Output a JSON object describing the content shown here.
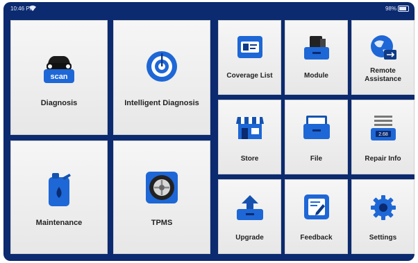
{
  "status": {
    "time": "10:46 PM",
    "battery_percent": "98%",
    "icons": [
      "wifi-icon",
      "battery-icon"
    ]
  },
  "left_panel": {
    "tiles": [
      {
        "label": "Diagnosis",
        "icon": "car-scan-icon",
        "icon_text": "scan"
      },
      {
        "label": "Intelligent Diagnosis",
        "icon": "radar-icon"
      },
      {
        "label": "Maintenance",
        "icon": "oil-can-icon"
      },
      {
        "label": "TPMS",
        "icon": "wheel-icon"
      }
    ]
  },
  "right_panel": {
    "tiles": [
      {
        "label": "Coverage List",
        "icon": "coverage-list-icon"
      },
      {
        "label": "Module",
        "icon": "module-icon"
      },
      {
        "label": "Remote Assistance",
        "icon": "remote-assistance-icon"
      },
      {
        "label": "Store",
        "icon": "store-icon"
      },
      {
        "label": "File",
        "icon": "file-icon"
      },
      {
        "label": "Repair Info",
        "icon": "repair-info-icon",
        "icon_text": "2.68"
      },
      {
        "label": "Upgrade",
        "icon": "upgrade-icon"
      },
      {
        "label": "Feedback",
        "icon": "feedback-icon"
      },
      {
        "label": "Settings",
        "icon": "settings-icon"
      }
    ]
  },
  "colors": {
    "background": "#0b2a6f",
    "tile_light": "#f6f6f6",
    "icon_blue": "#1e67d6",
    "icon_dark": "#0f3a86"
  }
}
